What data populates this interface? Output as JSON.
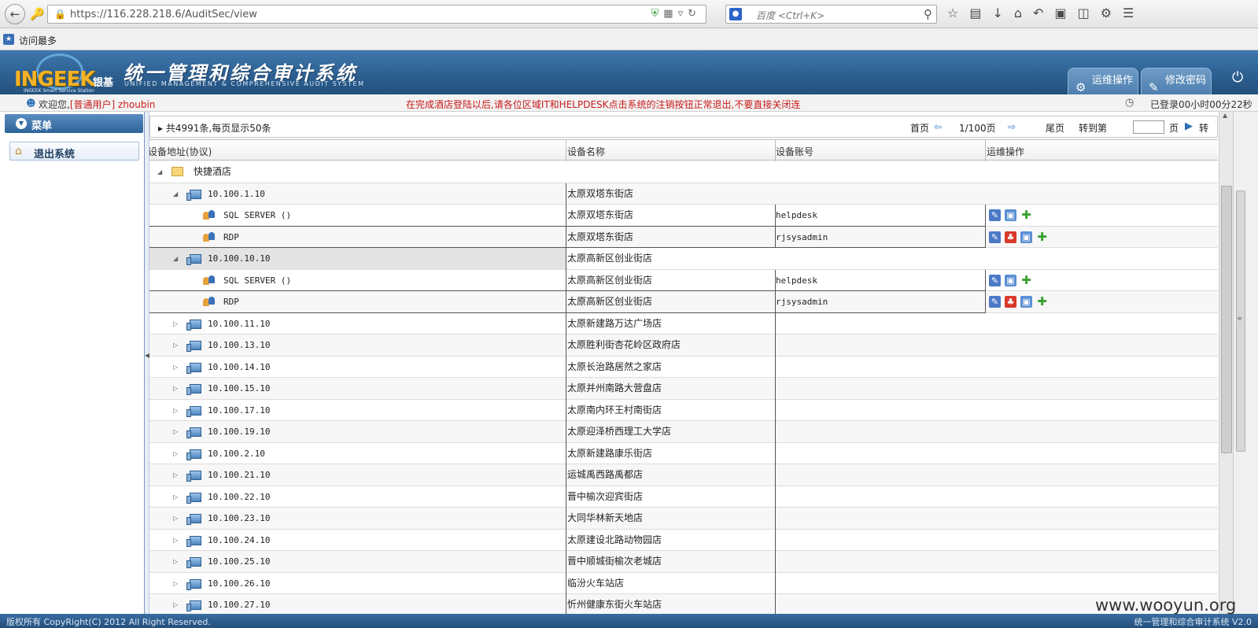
{
  "browser": {
    "url": "https://116.228.218.6/AuditSec/view",
    "search_placeholder": "百度 <Ctrl+K>",
    "bookmark_label": "访问最多"
  },
  "header": {
    "logo_text": "INGEEK",
    "logo_cn": "银基",
    "logo_sub": "INGEEK Smart Service Station",
    "title": "统一管理和综合审计系统",
    "title_en": "UNIFIED MANAGEMENT & COMPREHENSIVE AUDIT SYSTEM",
    "tab_ops": "运维操作",
    "tab_password": "修改密码"
  },
  "status": {
    "welcome": "欢迎您,",
    "role": "[普通用户] zhoubin",
    "notice": "在完成酒店登陆以后,请各位区域IT和HELPDESK点击系统的注销按钮正常退出,不要直接关闭连",
    "login_time": "已登录00小时00分22秒"
  },
  "sidebar": {
    "menu_title": "菜单",
    "logout_label": "退出系统"
  },
  "pager": {
    "total": "共4991条,每页显示50条",
    "first": "首页",
    "page_info": "1/100页",
    "last": "尾页",
    "goto": "转到第",
    "page_unit": "页",
    "go": "转"
  },
  "columns": {
    "address": "设备地址(协议)",
    "name": "设备名称",
    "account": "设备账号",
    "ops": "运维操作"
  },
  "rows": {
    "r0": {
      "label": "快捷酒店"
    },
    "r1": {
      "label": "10.100.1.10",
      "name": "太原双塔东街店"
    },
    "r2": {
      "label": "SQL SERVER  ()",
      "name": "太原双塔东街店",
      "account": "helpdesk"
    },
    "r3": {
      "label": "RDP",
      "name": "太原双塔东街店",
      "account": "rjsysadmin"
    },
    "r4": {
      "label": "10.100.10.10",
      "name": "太原高新区创业街店"
    },
    "r5": {
      "label": "SQL SERVER  ()",
      "name": "太原高新区创业街店",
      "account": "helpdesk"
    },
    "r6": {
      "label": "RDP",
      "name": "太原高新区创业街店",
      "account": "rjsysadmin"
    },
    "r7": {
      "label": "10.100.11.10",
      "name": "太原新建路万达广场店"
    },
    "r8": {
      "label": "10.100.13.10",
      "name": "太原胜利街杏花岭区政府店"
    },
    "r9": {
      "label": "10.100.14.10",
      "name": "太原长治路居然之家店"
    },
    "r10": {
      "label": "10.100.15.10",
      "name": "太原并州南路大营盘店"
    },
    "r11": {
      "label": "10.100.17.10",
      "name": "太原南内环王村南街店"
    },
    "r12": {
      "label": "10.100.19.10",
      "name": "太原迎泽桥西理工大学店"
    },
    "r13": {
      "label": "10.100.2.10",
      "name": "太原新建路康乐街店"
    },
    "r14": {
      "label": "10.100.21.10",
      "name": "运城禹西路禹都店"
    },
    "r15": {
      "label": "10.100.22.10",
      "name": "晋中榆次迎宾街店"
    },
    "r16": {
      "label": "10.100.23.10",
      "name": "大同华林新天地店"
    },
    "r17": {
      "label": "10.100.24.10",
      "name": "太原建设北路动物园店"
    },
    "r18": {
      "label": "10.100.25.10",
      "name": "晋中顺城街榆次老城店"
    },
    "r19": {
      "label": "10.100.26.10",
      "name": "临汾火车站店"
    },
    "r20": {
      "label": "10.100.27.10",
      "name": "忻州健康东街火车站店"
    }
  },
  "footer": {
    "copyright": "版权所有 CopyRight(C) 2012 All Right Reserved.",
    "version": "统一管理和综合审计系统 V2.0"
  },
  "watermark": "www.wooyun.org",
  "colors": {
    "header_blue": "#2c5e8f",
    "notice_red": "#c81a1a",
    "logo_gold": "#f5b325"
  }
}
